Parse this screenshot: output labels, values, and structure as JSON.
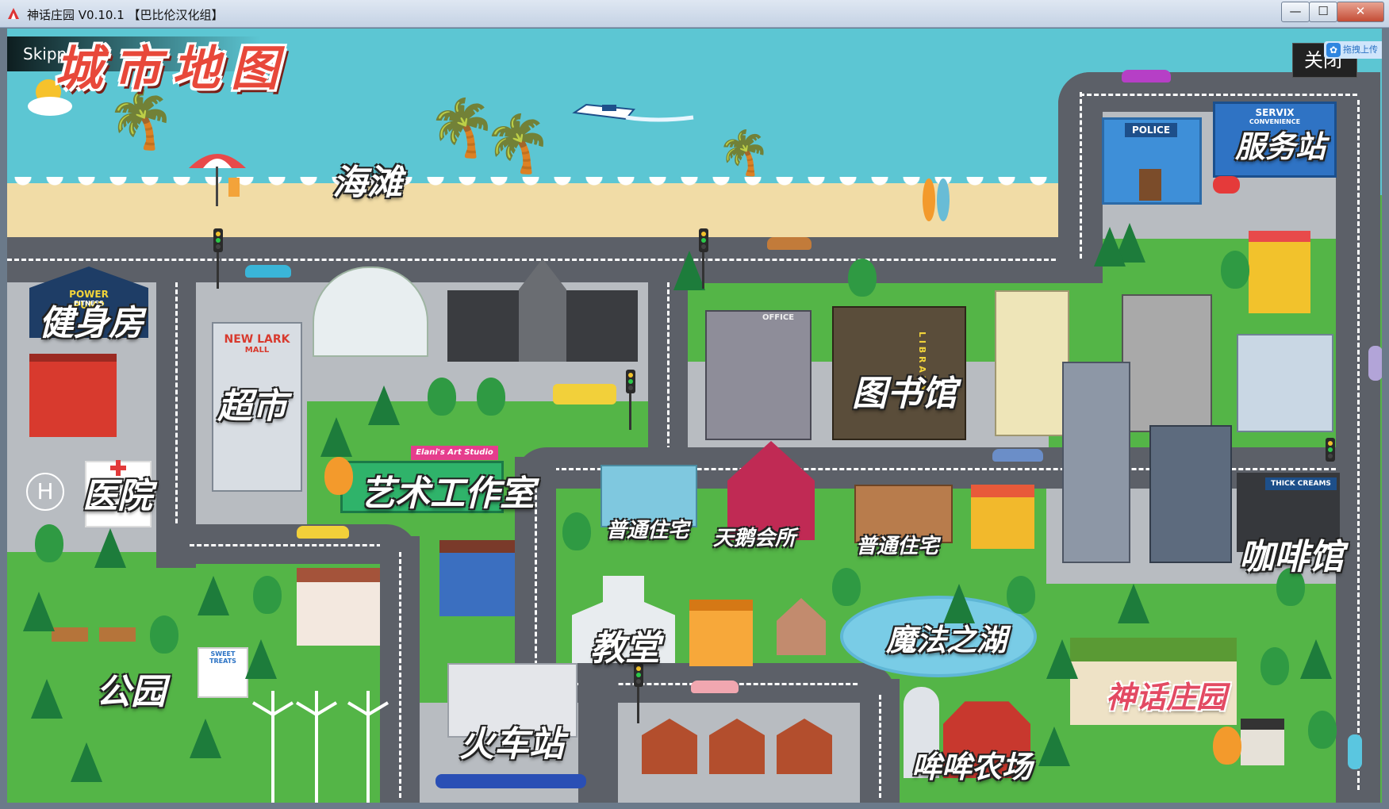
{
  "window": {
    "title": "神话庄园 V0.10.1 【巴比伦汉化组】",
    "controls": {
      "minimize": "—",
      "maximize": "☐",
      "close": "✕"
    }
  },
  "overlay": {
    "skip_label": "Skipping",
    "close_label": "关闭",
    "upload_label": "拖拽上传"
  },
  "map": {
    "title": "城市地图",
    "locations": {
      "beach": "海滩",
      "service_station": "服务站",
      "gym": "健身房",
      "supermarket": "超市",
      "library": "图书馆",
      "hospital": "医院",
      "art_studio": "艺术工作室",
      "house_1": "普通住宅",
      "swan_club": "天鹅会所",
      "house_2": "普通住宅",
      "cafe": "咖啡馆",
      "church": "教堂",
      "magic_lake": "魔法之湖",
      "park": "公园",
      "train_station": "火车站",
      "moo_farm": "哞哞农场",
      "mythic_manor": "神话庄园"
    },
    "signs": {
      "police": "POLICE",
      "servix": "SERVIX",
      "servix_sub": "CONVENIENCE",
      "powerpump": "POWER PUMP",
      "powerpump_sub": "FITNESS",
      "newlark": "NEW LARK",
      "newlark_sub": "MALL",
      "office": "OFFICE",
      "library_vertical": "L I B R A R Y",
      "art_sign": "Elani's Art Studio",
      "thick_creams": "THICK CREAMS",
      "sweet_treats": "SWEET TREATS",
      "hospital_h": "H"
    }
  }
}
